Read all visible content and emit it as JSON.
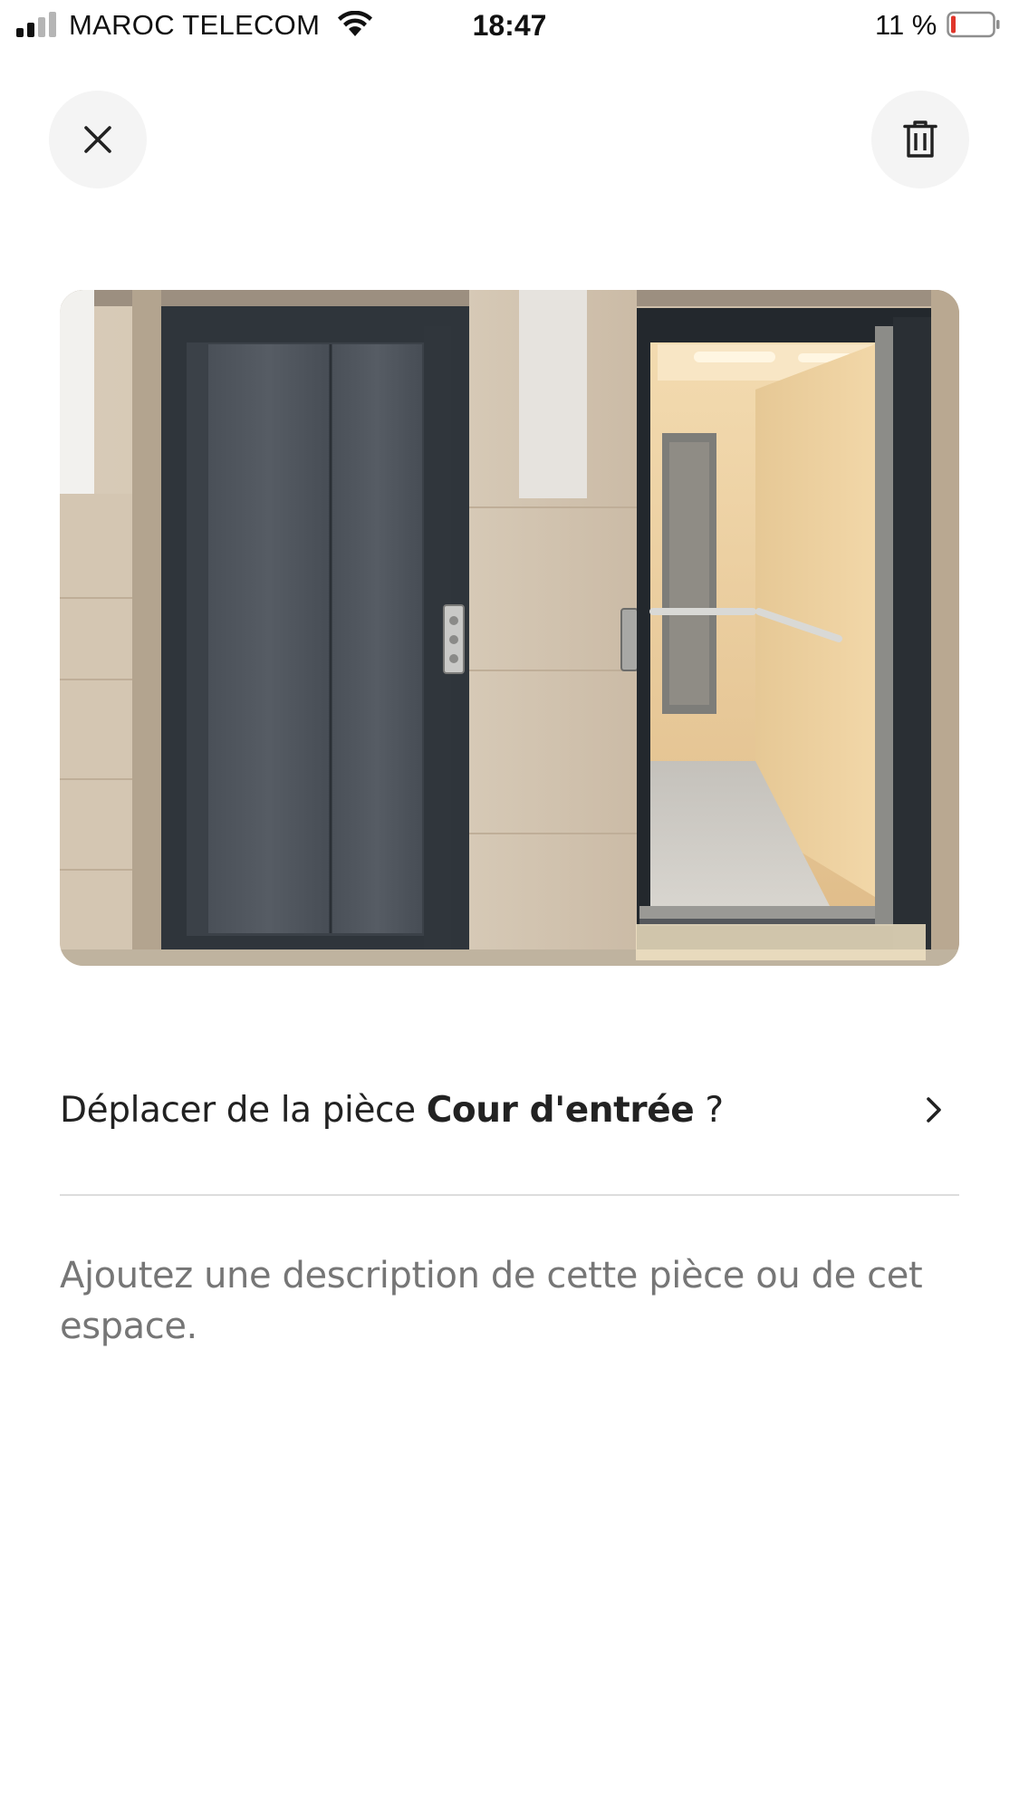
{
  "status_bar": {
    "carrier": "MAROC TELECOM",
    "time": "18:47",
    "battery_percent": "11 %",
    "battery_level": 0.11,
    "signal_bars": 2,
    "icons": [
      "signal-icon",
      "wifi-icon",
      "battery-icon"
    ],
    "battery_color": "#e0362b"
  },
  "header": {
    "close_icon": "close-icon",
    "delete_icon": "trash-icon"
  },
  "photo": {
    "subject": "elevator-doors-photo"
  },
  "move_room": {
    "prefix": "Déplacer de la pièce ",
    "room_name": "Cour d'entrée",
    "suffix": " ?",
    "icon": "chevron-right-icon"
  },
  "description": {
    "placeholder": "Ajoutez une description de cette pièce ou de cet espace."
  },
  "colors": {
    "text_primary": "#222222",
    "text_secondary": "#767676",
    "button_background": "#f4f4f4",
    "divider": "#dddddd"
  }
}
